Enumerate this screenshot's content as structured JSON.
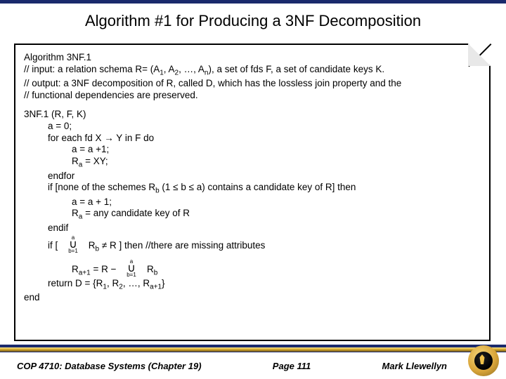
{
  "title": "Algorithm #1 for Producing a 3NF Decomposition",
  "algo": {
    "name": "Algorithm 3NF.1",
    "input": "// input: a relation schema R= (A",
    "input_tail": "),   a set of fds F, a set of candidate keys K.",
    "output1": "// output:  a 3NF decomposition of R, called D, which has the lossless join property and the",
    "output2": "//                functional dependencies are preserved.",
    "sig": "3NF.1 (R, F, K)",
    "l1": "a = 0;",
    "l2a": "for each fd X ",
    "l2b": " Y in F do",
    "l3": "a = a +1;",
    "l4a": "R",
    "l4b": " = XY;",
    "l5": "endfor",
    "l6a": "if [none of the schemes R",
    "l6b": " (1 ",
    "l6c": " b ",
    "l6d": " a) contains a candidate key of R] then",
    "l7": "a = a + 1;",
    "l8a": "R",
    "l8b": " = any candidate key of R",
    "l9": "endif",
    "l10a": "if [ ",
    "l10b": " R ",
    "l10c": "   ] then   //there are missing attributes",
    "l11a": "R",
    "l11b": " = ",
    "l12a": "return D = {R",
    "l12b": ", R",
    "l12c": ", …, R",
    "l12d": "}",
    "l13": "end"
  },
  "sub": {
    "one": "1",
    "two": "2",
    "n": "n",
    "a": "a",
    "b": "b",
    "ap1": "a+1"
  },
  "sym": {
    "arrow": "→",
    "leq": "≤",
    "neq": "≠",
    "minus": "−",
    "ellipsis": "…"
  },
  "union": {
    "top": "a",
    "bottom": "b=1",
    "body": "R",
    "bodysub": "b"
  },
  "footer": {
    "left": "COP 4710: Database Systems  (Chapter 19)",
    "center": "Page 111",
    "right": "Mark Llewellyn"
  }
}
